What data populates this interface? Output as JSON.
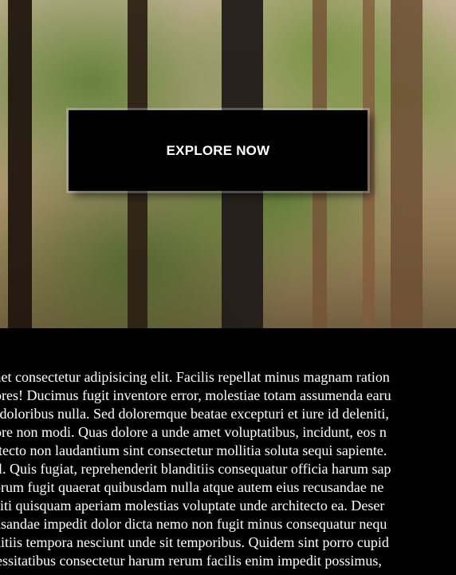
{
  "hero": {
    "cta_label": "EXPLORE NOW"
  },
  "content": {
    "lines": [
      "t amet consectetur adipisicing elit. Facilis repellat minus magnam ration",
      "dolores! Ducimus fugit inventore error, molestiae totam assumenda earu",
      "nos doloribus nulla. Sed doloremque beatae excepturi et iure id deleniti,",
      "dolore non modi. Quas dolore a unde amet voluptatibus, incidunt, eos n",
      "rchitecto non laudantium sint consectetur mollitia soluta sequi sapiente.",
      "nihil. Quis fugiat, reprehenderit blanditiis consequatur officia harum sap",
      " laborum fugit quaerat quibusdam nulla atque autem eius recusandae ne",
      "eleniti quisquam aperiam molestias voluptate unde architecto ea. Deser",
      "recusandae impedit dolor dicta nemo non fugit minus consequatur nequ",
      "landitiis tempora nesciunt unde sit temporibus. Quidem sint porro cupid",
      "necessitatibus consectetur harum rerum facilis enim impedit possimus, "
    ]
  },
  "colors": {
    "button_bg": "#000000",
    "button_text": "#ffffff",
    "page_bg": "#000000"
  },
  "icons": {
    "hero_image": "forest-photo"
  }
}
